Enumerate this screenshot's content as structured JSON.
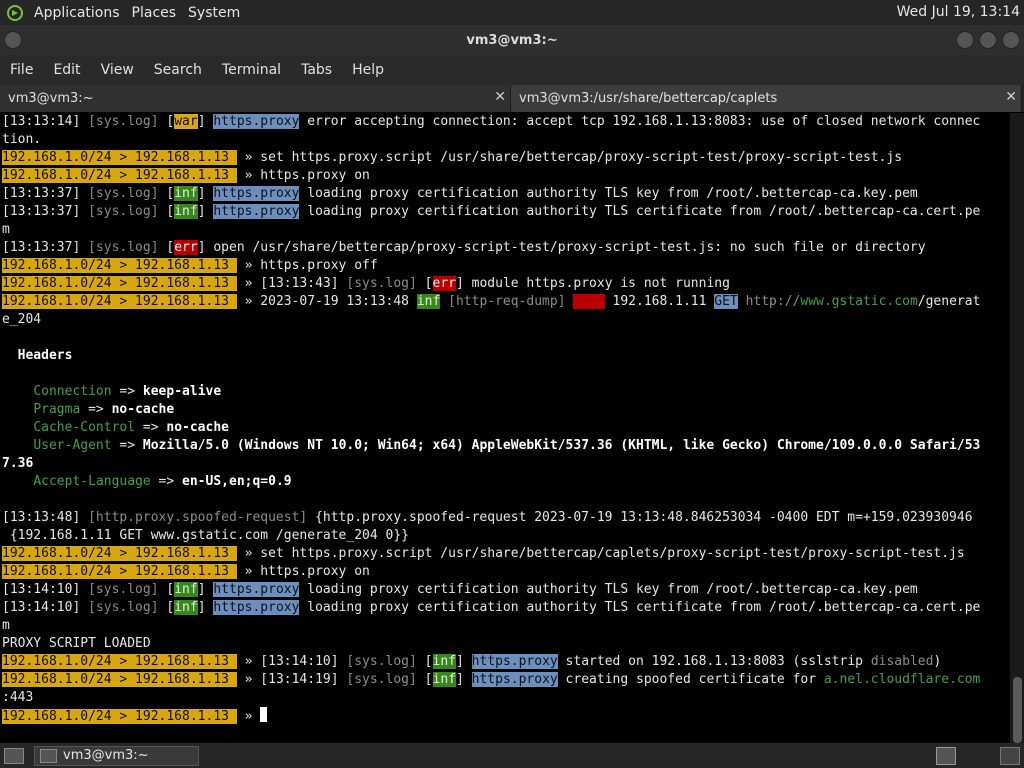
{
  "top_panel": {
    "menus": [
      "Applications",
      "Places",
      "System"
    ],
    "clock": "Wed Jul 19, 13:14"
  },
  "window": {
    "title": "vm3@vm3:~"
  },
  "menubar": [
    "File",
    "Edit",
    "View",
    "Search",
    "Terminal",
    "Tabs",
    "Help"
  ],
  "tabs": [
    {
      "label": "vm3@vm3:~",
      "active": true
    },
    {
      "label": "vm3@vm3:/usr/share/bettercap/caplets",
      "active": false
    }
  ],
  "colors": {
    "prompt_bg": "#d7a610",
    "inf_bg": "#37881a",
    "err_bg": "#b80000",
    "module_bg": "#6b8fbf"
  },
  "terminal_lines": [
    [
      [
        "[13:13:14] ",
        ""
      ],
      [
        "[sys.log]",
        "dim"
      ],
      [
        " [",
        ""
      ],
      [
        "war",
        "war"
      ],
      [
        "] ",
        ""
      ],
      [
        "https.proxy",
        "mod"
      ],
      [
        " error accepting connection: accept tcp 192.168.1.13:8083: use of closed network connec",
        ""
      ]
    ],
    [
      [
        "tion.",
        ""
      ]
    ],
    [
      [
        "192.168.1.0/24 > 192.168.1.13 ",
        "prompt"
      ],
      [
        " » set https.proxy.script /usr/share/bettercap/proxy-script-test/proxy-script-test.js",
        ""
      ]
    ],
    [
      [
        "192.168.1.0/24 > 192.168.1.13 ",
        "prompt"
      ],
      [
        " » https.proxy on",
        ""
      ]
    ],
    [
      [
        "[13:13:37] ",
        ""
      ],
      [
        "[sys.log]",
        "dim"
      ],
      [
        " [",
        ""
      ],
      [
        "inf",
        "inf"
      ],
      [
        "] ",
        ""
      ],
      [
        "https.proxy",
        "mod"
      ],
      [
        " loading proxy certification authority TLS key from /root/.bettercap-ca.key.pem",
        ""
      ]
    ],
    [
      [
        "[13:13:37] ",
        ""
      ],
      [
        "[sys.log]",
        "dim"
      ],
      [
        " [",
        ""
      ],
      [
        "inf",
        "inf"
      ],
      [
        "] ",
        ""
      ],
      [
        "https.proxy",
        "mod"
      ],
      [
        " loading proxy certification authority TLS certificate from /root/.bettercap-ca.cert.pe",
        ""
      ]
    ],
    [
      [
        "m",
        ""
      ]
    ],
    [
      [
        "[13:13:37] ",
        ""
      ],
      [
        "[sys.log]",
        "dim"
      ],
      [
        " [",
        ""
      ],
      [
        "err",
        "err"
      ],
      [
        "] open /usr/share/bettercap/proxy-script-test/proxy-script-test.js: no such file or directory",
        ""
      ]
    ],
    [
      [
        "192.168.1.0/24 > 192.168.1.13 ",
        "prompt"
      ],
      [
        " » https.proxy off",
        ""
      ]
    ],
    [
      [
        "192.168.1.0/24 > 192.168.1.13 ",
        "prompt"
      ],
      [
        " » [13:13:43] ",
        ""
      ],
      [
        "[sys.log]",
        "dim"
      ],
      [
        " [",
        ""
      ],
      [
        "err",
        "err"
      ],
      [
        "] module https.proxy is not running",
        ""
      ]
    ],
    [
      [
        "192.168.1.0/24 > 192.168.1.13 ",
        "prompt"
      ],
      [
        " » 2023-07-19 13:13:48 ",
        ""
      ],
      [
        "inf",
        "inf"
      ],
      [
        " ",
        ""
      ],
      [
        "[http-req-dump]",
        "dim"
      ],
      [
        " ",
        ""
      ],
      [
        "    ",
        "err"
      ],
      [
        " 192.168.1.11 ",
        ""
      ],
      [
        "GET",
        "mod"
      ],
      [
        " ",
        ""
      ],
      [
        "http://",
        "dim"
      ],
      [
        "www.gstatic.com",
        "hdr"
      ],
      [
        "/generat",
        ""
      ]
    ],
    [
      [
        "e_204",
        ""
      ]
    ],
    [
      [
        "",
        ""
      ]
    ],
    [
      [
        "  Headers",
        "bold"
      ]
    ],
    [
      [
        "",
        ""
      ]
    ],
    [
      [
        "    ",
        ""
      ],
      [
        "Connection",
        "hdr"
      ],
      [
        " => ",
        ""
      ],
      [
        "keep-alive",
        "bold"
      ]
    ],
    [
      [
        "    ",
        ""
      ],
      [
        "Pragma",
        "hdr"
      ],
      [
        " => ",
        ""
      ],
      [
        "no-cache",
        "bold"
      ]
    ],
    [
      [
        "    ",
        ""
      ],
      [
        "Cache-Control",
        "hdr"
      ],
      [
        " => ",
        ""
      ],
      [
        "no-cache",
        "bold"
      ]
    ],
    [
      [
        "    ",
        ""
      ],
      [
        "User-Agent",
        "hdr"
      ],
      [
        " => ",
        ""
      ],
      [
        "Mozilla/5.0 (Windows NT 10.0; Win64; x64) AppleWebKit/537.36 (KHTML, like Gecko) Chrome/109.0.0.0 Safari/53",
        "bold"
      ]
    ],
    [
      [
        "7.36",
        "bold"
      ]
    ],
    [
      [
        "    ",
        ""
      ],
      [
        "Accept-Language",
        "hdr"
      ],
      [
        " => ",
        ""
      ],
      [
        "en-US,en;q=0.9",
        "bold"
      ]
    ],
    [
      [
        "",
        ""
      ]
    ],
    [
      [
        "[13:13:48] ",
        ""
      ],
      [
        "[http.proxy.spoofed-request]",
        "dim"
      ],
      [
        " {http.proxy.spoofed-request 2023-07-19 13:13:48.846253034 -0400 EDT m=+159.023930946",
        ""
      ]
    ],
    [
      [
        " {192.168.1.11 GET www.gstatic.com /generate_204 0}}",
        ""
      ]
    ],
    [
      [
        "192.168.1.0/24 > 192.168.1.13 ",
        "prompt"
      ],
      [
        " » set https.proxy.script /usr/share/bettercap/caplets/proxy-script-test/proxy-script-test.js",
        ""
      ]
    ],
    [
      [
        "192.168.1.0/24 > 192.168.1.13 ",
        "prompt"
      ],
      [
        " » https.proxy on",
        ""
      ]
    ],
    [
      [
        "[13:14:10] ",
        ""
      ],
      [
        "[sys.log]",
        "dim"
      ],
      [
        " [",
        ""
      ],
      [
        "inf",
        "inf"
      ],
      [
        "] ",
        ""
      ],
      [
        "https.proxy",
        "mod"
      ],
      [
        " loading proxy certification authority TLS key from /root/.bettercap-ca.key.pem",
        ""
      ]
    ],
    [
      [
        "[13:14:10] ",
        ""
      ],
      [
        "[sys.log]",
        "dim"
      ],
      [
        " [",
        ""
      ],
      [
        "inf",
        "inf"
      ],
      [
        "] ",
        ""
      ],
      [
        "https.proxy",
        "mod"
      ],
      [
        " loading proxy certification authority TLS certificate from /root/.bettercap-ca.cert.pe",
        ""
      ]
    ],
    [
      [
        "m",
        ""
      ]
    ],
    [
      [
        "PROXY SCRIPT LOADED",
        ""
      ]
    ],
    [
      [
        "192.168.1.0/24 > 192.168.1.13 ",
        "prompt"
      ],
      [
        " » [13:14:10] ",
        ""
      ],
      [
        "[sys.log]",
        "dim"
      ],
      [
        " [",
        ""
      ],
      [
        "inf",
        "inf"
      ],
      [
        "] ",
        ""
      ],
      [
        "https.proxy",
        "mod"
      ],
      [
        " started on 192.168.1.13:8083 (sslstrip ",
        ""
      ],
      [
        "disabled",
        "dim"
      ],
      [
        ")",
        ""
      ]
    ],
    [
      [
        "192.168.1.0/24 > 192.168.1.13 ",
        "prompt"
      ],
      [
        " » [13:14:19] ",
        ""
      ],
      [
        "[sys.log]",
        "dim"
      ],
      [
        " [",
        ""
      ],
      [
        "inf",
        "inf"
      ],
      [
        "] ",
        ""
      ],
      [
        "https.proxy",
        "mod"
      ],
      [
        " creating spoofed certificate for ",
        ""
      ],
      [
        "a.nel.cloudflare.com",
        "hdr"
      ]
    ],
    [
      [
        ":443",
        ""
      ]
    ],
    [
      [
        "192.168.1.0/24 > 192.168.1.13 ",
        "prompt"
      ],
      [
        " » ",
        ""
      ]
    ]
  ],
  "taskbar": {
    "task_label": "vm3@vm3:~"
  }
}
